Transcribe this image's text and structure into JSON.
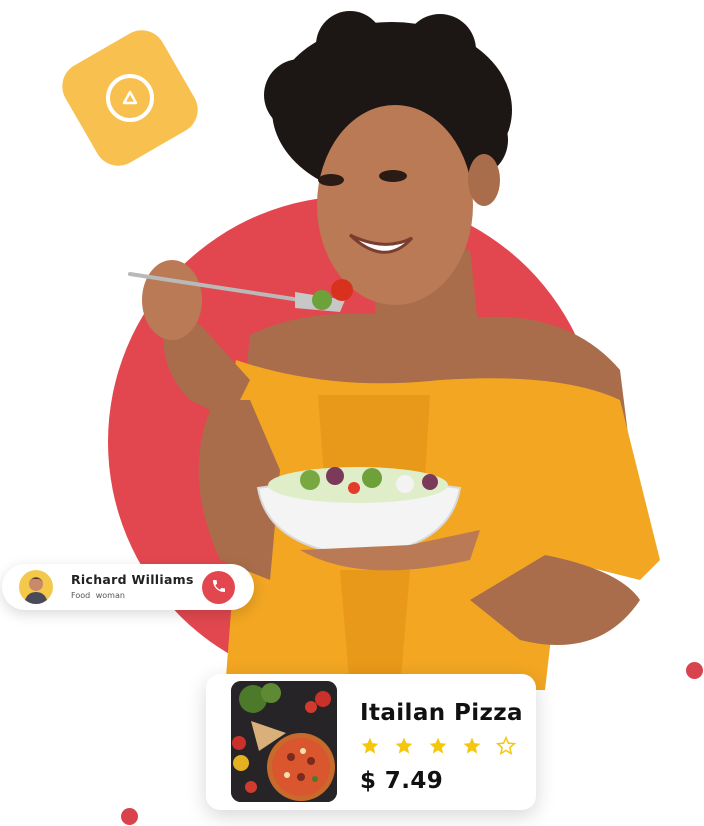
{
  "contact": {
    "name": "Richard Williams",
    "role": "Food woman",
    "action_icon": "phone-icon"
  },
  "product": {
    "name": "Itailan Pizza",
    "rating": 4,
    "rating_max": 5,
    "price": "$ 7.49"
  },
  "decor": {
    "badge_icon": "play-icon"
  },
  "colors": {
    "accent": "#e2474f",
    "badge": "#f8c14f",
    "star": "#f5c70c",
    "dress": "#f2a622"
  }
}
